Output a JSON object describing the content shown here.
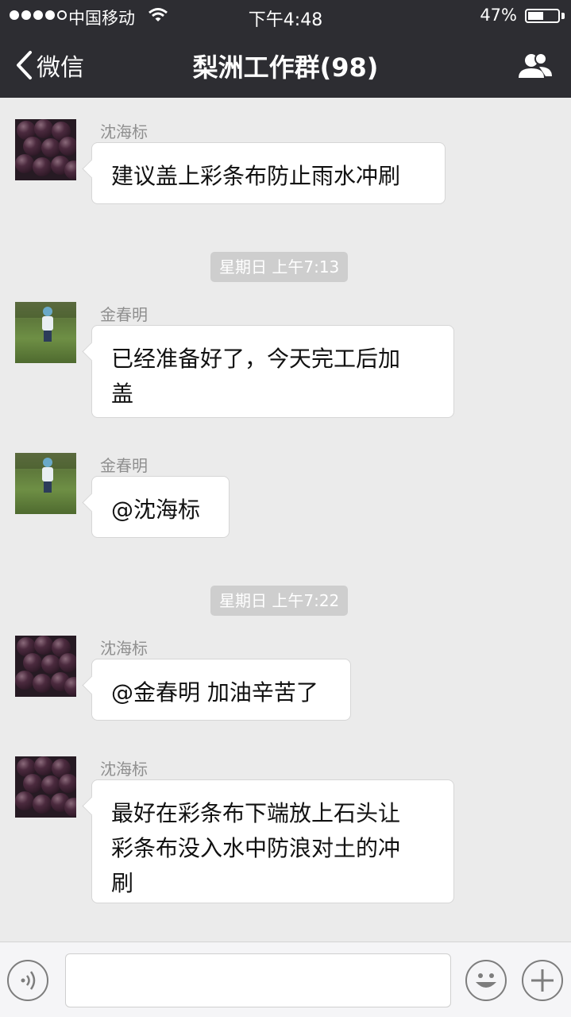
{
  "status_bar": {
    "carrier": "中国移动",
    "time": "下午4:48",
    "battery": "47%",
    "battery_level": 0.47
  },
  "nav": {
    "back_label": "微信",
    "title": "梨洲工作群(98)",
    "back_icon": "chevron-left-icon",
    "right_icon": "group-members-icon"
  },
  "messages": [
    {
      "sender": "沈海标",
      "lines": [
        "建议盖上彩条布防止雨水冲刷"
      ]
    },
    {
      "timestamp": "星期日 上午7:13"
    },
    {
      "sender": "金春明",
      "lines": [
        "已经准备好了，今天完工后加",
        "盖"
      ]
    },
    {
      "sender": "金春明",
      "lines": [
        "@沈海标"
      ]
    },
    {
      "timestamp": "星期日 上午7:22"
    },
    {
      "sender": "沈海标",
      "lines": [
        "@金春明 加油辛苦了"
      ]
    },
    {
      "sender": "沈海标",
      "lines": [
        "最好在彩条布下端放上石头让",
        "彩条布没入水中防浪对土的冲",
        "刷"
      ]
    }
  ],
  "input_bar": {
    "voice_icon": "voice-icon",
    "text_value": "",
    "emoji_icon": "emoji-icon",
    "plus_icon": "plus-icon"
  },
  "colors": {
    "header_bg": "#2d2d32",
    "chat_bg": "#ebebeb",
    "bubble_bg": "#ffffff",
    "timestamp_bg": "#cecece"
  }
}
